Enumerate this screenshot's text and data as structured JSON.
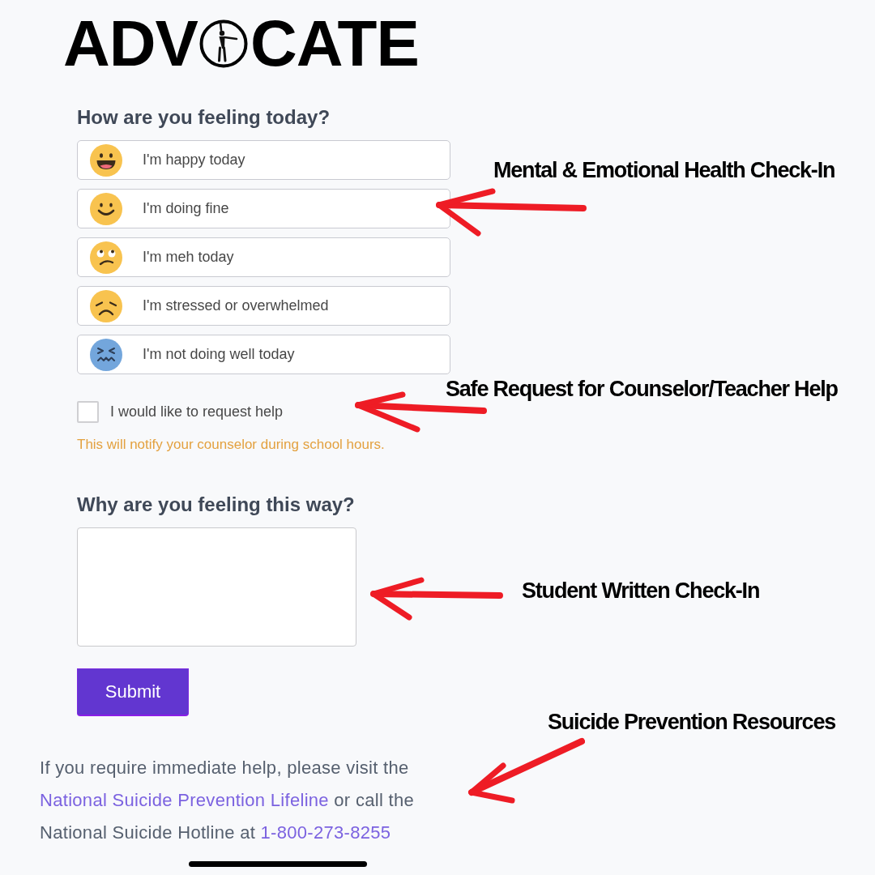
{
  "logo": {
    "left": "ADV",
    "right": "CATE"
  },
  "mood_section": {
    "heading": "How are you feeling today?"
  },
  "moods": [
    {
      "label": "I'm happy today",
      "kind": "grinning",
      "selected": false
    },
    {
      "label": "I'm doing fine",
      "kind": "smiling",
      "selected": false
    },
    {
      "label": "I'm meh today",
      "kind": "rolling-eyes",
      "selected": false
    },
    {
      "label": "I'm stressed or overwhelmed",
      "kind": "disappointed",
      "selected": false
    },
    {
      "label": "I'm not doing well today",
      "kind": "confounded",
      "selected": false
    }
  ],
  "help_request": {
    "label": "I would like to request help",
    "checked": false,
    "note": "This will notify your counselor during school hours."
  },
  "reason_section": {
    "heading": "Why are you feeling this way?"
  },
  "submit_button": {
    "label": "Submit"
  },
  "footer": {
    "text_before": "If you require immediate help, please visit the",
    "link": "National Suicide Prevention Lifeline",
    "text_middle": "or call the National Suicide Hotline at",
    "phone": "1-800-273-8255"
  },
  "annotations": [
    {
      "text": "Mental & Emotional Health Check-In"
    },
    {
      "text": "Safe Request for Counselor/Teacher Help"
    },
    {
      "text": "Student Written Check-In"
    },
    {
      "text": "Suicide Prevention Resources"
    }
  ]
}
